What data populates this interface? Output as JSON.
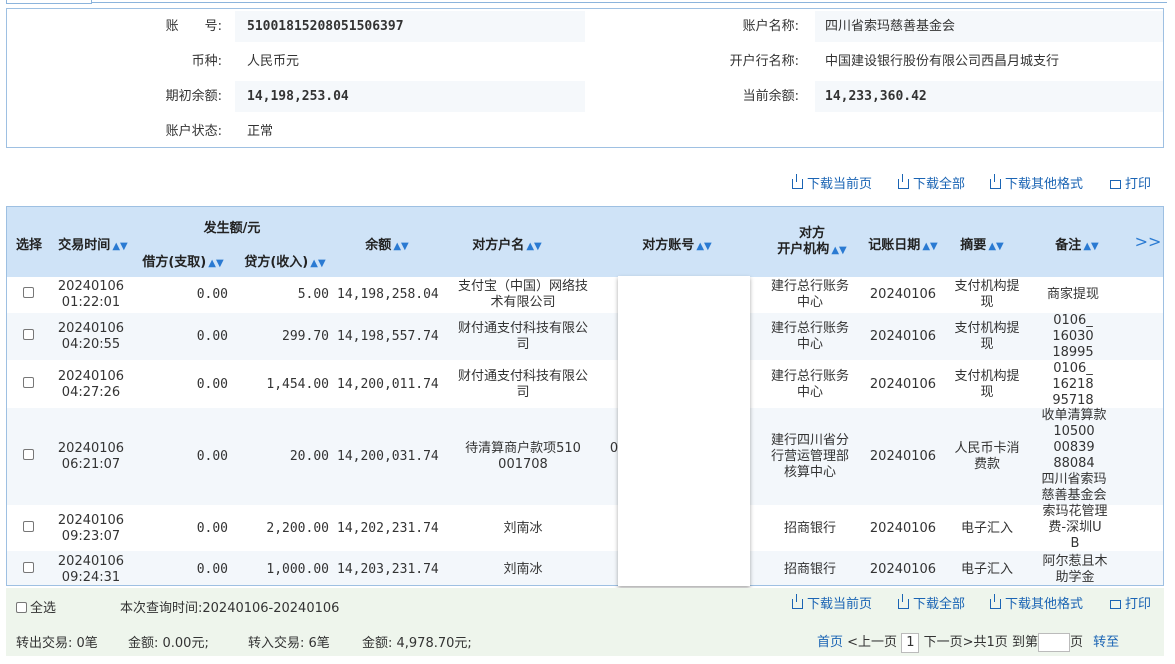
{
  "account": {
    "no_label": "账　　号:",
    "no_value": "51001815208051506397",
    "name_label": "账户名称:",
    "name_value": "四川省索玛慈善基金会",
    "currency_label": "币种:",
    "currency_value": "人民币元",
    "bank_label": "开户行名称:",
    "bank_value": "中国建设银行股份有限公司西昌月城支行",
    "opening_label": "期初余额:",
    "opening_value": "14,198,253.04",
    "current_label": "当前余额:",
    "current_value": "14,233,360.42",
    "status_label": "账户状态:",
    "status_value": "正常"
  },
  "toolbar": {
    "download_page": "下载当前页",
    "download_all": "下载全部",
    "download_other": "下载其他格式",
    "print": "打印"
  },
  "table": {
    "headers": {
      "select": "选择",
      "time": "交易时间",
      "amount_group": "发生额/元",
      "debit": "借方(支取)",
      "credit": "贷方(收入)",
      "balance": "余额",
      "party_name": "对方户名",
      "party_account": "对方账号",
      "party_bank_1": "对方",
      "party_bank_2": "开户机构",
      "post_date": "记账日期",
      "summary": "摘要",
      "remark": "备注",
      "more": ">>"
    },
    "rows": [
      {
        "time_1": "20240106",
        "time_2": "01:22:01",
        "debit": "0.00",
        "credit": "5.00",
        "balance": "14,198,258.04",
        "party_1": "支付宝（中国）网络技",
        "party_2": "术有限公司",
        "bank_1": "建行总行账务",
        "bank_2": "中心",
        "date": "20240106",
        "sum_1": "支付机构提",
        "sum_2": "现",
        "rem_1": "商家提现",
        "rem_2": "",
        "rem_3": "",
        "rem_4": "",
        "rem_5": ""
      },
      {
        "time_1": "20240106",
        "time_2": "04:20:55",
        "debit": "0.00",
        "credit": "299.70",
        "balance": "14,198,557.74",
        "party_1": "财付通支付科技有限公",
        "party_2": "司",
        "bank_1": "建行总行账务",
        "bank_2": "中心",
        "date": "20240106",
        "sum_1": "支付机构提",
        "sum_2": "现",
        "rem_1": "0106_",
        "rem_2": "16030",
        "rem_3": "18995",
        "rem_4": "",
        "rem_5": ""
      },
      {
        "time_1": "20240106",
        "time_2": "04:27:26",
        "debit": "0.00",
        "credit": "1,454.00",
        "balance": "14,200,011.74",
        "party_1": "财付通支付科技有限公",
        "party_2": "司",
        "bank_1": "建行总行账务",
        "bank_2": "中心",
        "date": "20240106",
        "sum_1": "支付机构提",
        "sum_2": "现",
        "rem_1": "0106_",
        "rem_2": "16218",
        "rem_3": "95718",
        "rem_4": "",
        "rem_5": ""
      },
      {
        "time_1": "20240106",
        "time_2": "06:21:07",
        "debit": "0.00",
        "credit": "20.00",
        "balance": "14,200,031.74",
        "party_1": "待清算商户款项510",
        "party_2": "001708",
        "acct": "0",
        "bank_1": "建行四川省分",
        "bank_2": "行营运管理部",
        "bank_3": "核算中心",
        "date": "20240106",
        "sum_1": "人民币卡消",
        "sum_2": "费款",
        "rem_1": "收单清算款",
        "rem_2": "10500",
        "rem_3": "00839",
        "rem_4": "88084",
        "rem_5": "四川省索玛",
        "rem_6": "慈善基金会"
      },
      {
        "time_1": "20240106",
        "time_2": "09:23:07",
        "debit": "0.00",
        "credit": "2,200.00",
        "balance": "14,202,231.74",
        "party_1": "刘南冰",
        "party_2": "",
        "bank_1": "招商银行",
        "bank_2": "",
        "date": "20240106",
        "sum_1": "电子汇入",
        "sum_2": "",
        "rem_1": "索玛花管理",
        "rem_2": "费-深圳U",
        "rem_3": "B",
        "rem_4": "",
        "rem_5": ""
      },
      {
        "time_1": "20240106",
        "time_2": "09:24:31",
        "debit": "0.00",
        "credit": "1,000.00",
        "balance": "14,203,231.74",
        "party_1": "刘南冰",
        "party_2": "",
        "bank_1": "招商银行",
        "bank_2": "",
        "date": "20240106",
        "sum_1": "电子汇入",
        "sum_2": "",
        "rem_1": "阿尔惹且木",
        "rem_2": "助学金",
        "rem_3": "",
        "rem_4": "",
        "rem_5": ""
      }
    ]
  },
  "footer": {
    "select_all": "全选",
    "query_time": "本次查询时间:20240106-20240106",
    "out_trans": "转出交易: 0笔",
    "out_amount": "金额: 0.00元;",
    "in_trans": "转入交易: 6笔",
    "in_amount": "金额: 4,978.70元;",
    "first": "首页",
    "prev": "<上一页",
    "page": "1",
    "next": "下一页>",
    "total": "共1页",
    "goto": "到第",
    "page_unit": "页",
    "go": "转至"
  },
  "colors": {
    "header_bg": "#cfe3f7",
    "link": "#1a64b4",
    "footer_bg": "#eef5ec",
    "border": "#9ec0e2"
  }
}
